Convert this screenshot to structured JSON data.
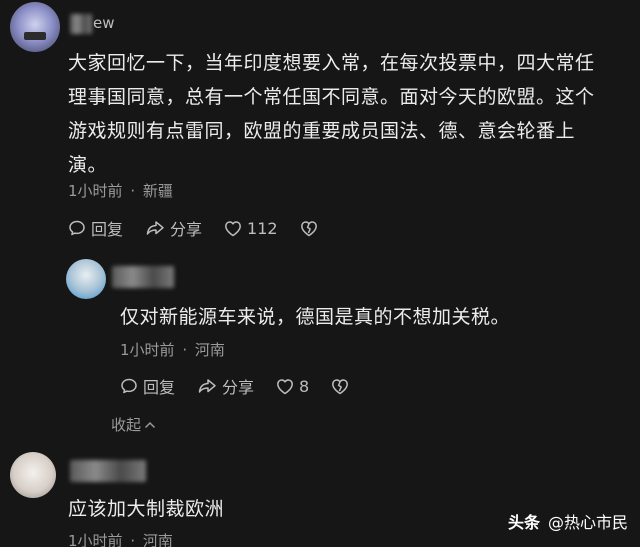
{
  "comments": [
    {
      "username_visible": "ew",
      "text_lines": [
        "大家回忆一下，当年印度想要入常，在每次投票中，四大常任",
        "理事国同意，总有一个常任国不同意。面对今天的欧盟。这个",
        "游戏规则有点雷同，欧盟的重要成员国法、德、意会轮番上",
        "演。"
      ],
      "time": "1小时前",
      "location": "新疆",
      "reply_label": "回复",
      "share_label": "分享",
      "likes": "112"
    },
    {
      "text": "仅对新能源车来说，德国是真的不想加关税。",
      "time": "1小时前",
      "location": "河南",
      "reply_label": "回复",
      "share_label": "分享",
      "likes": "8",
      "collapse_label": "收起"
    },
    {
      "text": "应该加大制裁欧洲",
      "time": "1小时前",
      "location": "河南"
    }
  ],
  "meta_separator": "·",
  "watermark": {
    "brand": "头条",
    "account": "@热心市民"
  },
  "icons": {
    "reply": "speech-bubble-icon",
    "share": "share-arrow-icon",
    "like": "heart-icon",
    "dislike": "broken-heart-icon",
    "collapse": "chevron-up-icon"
  }
}
